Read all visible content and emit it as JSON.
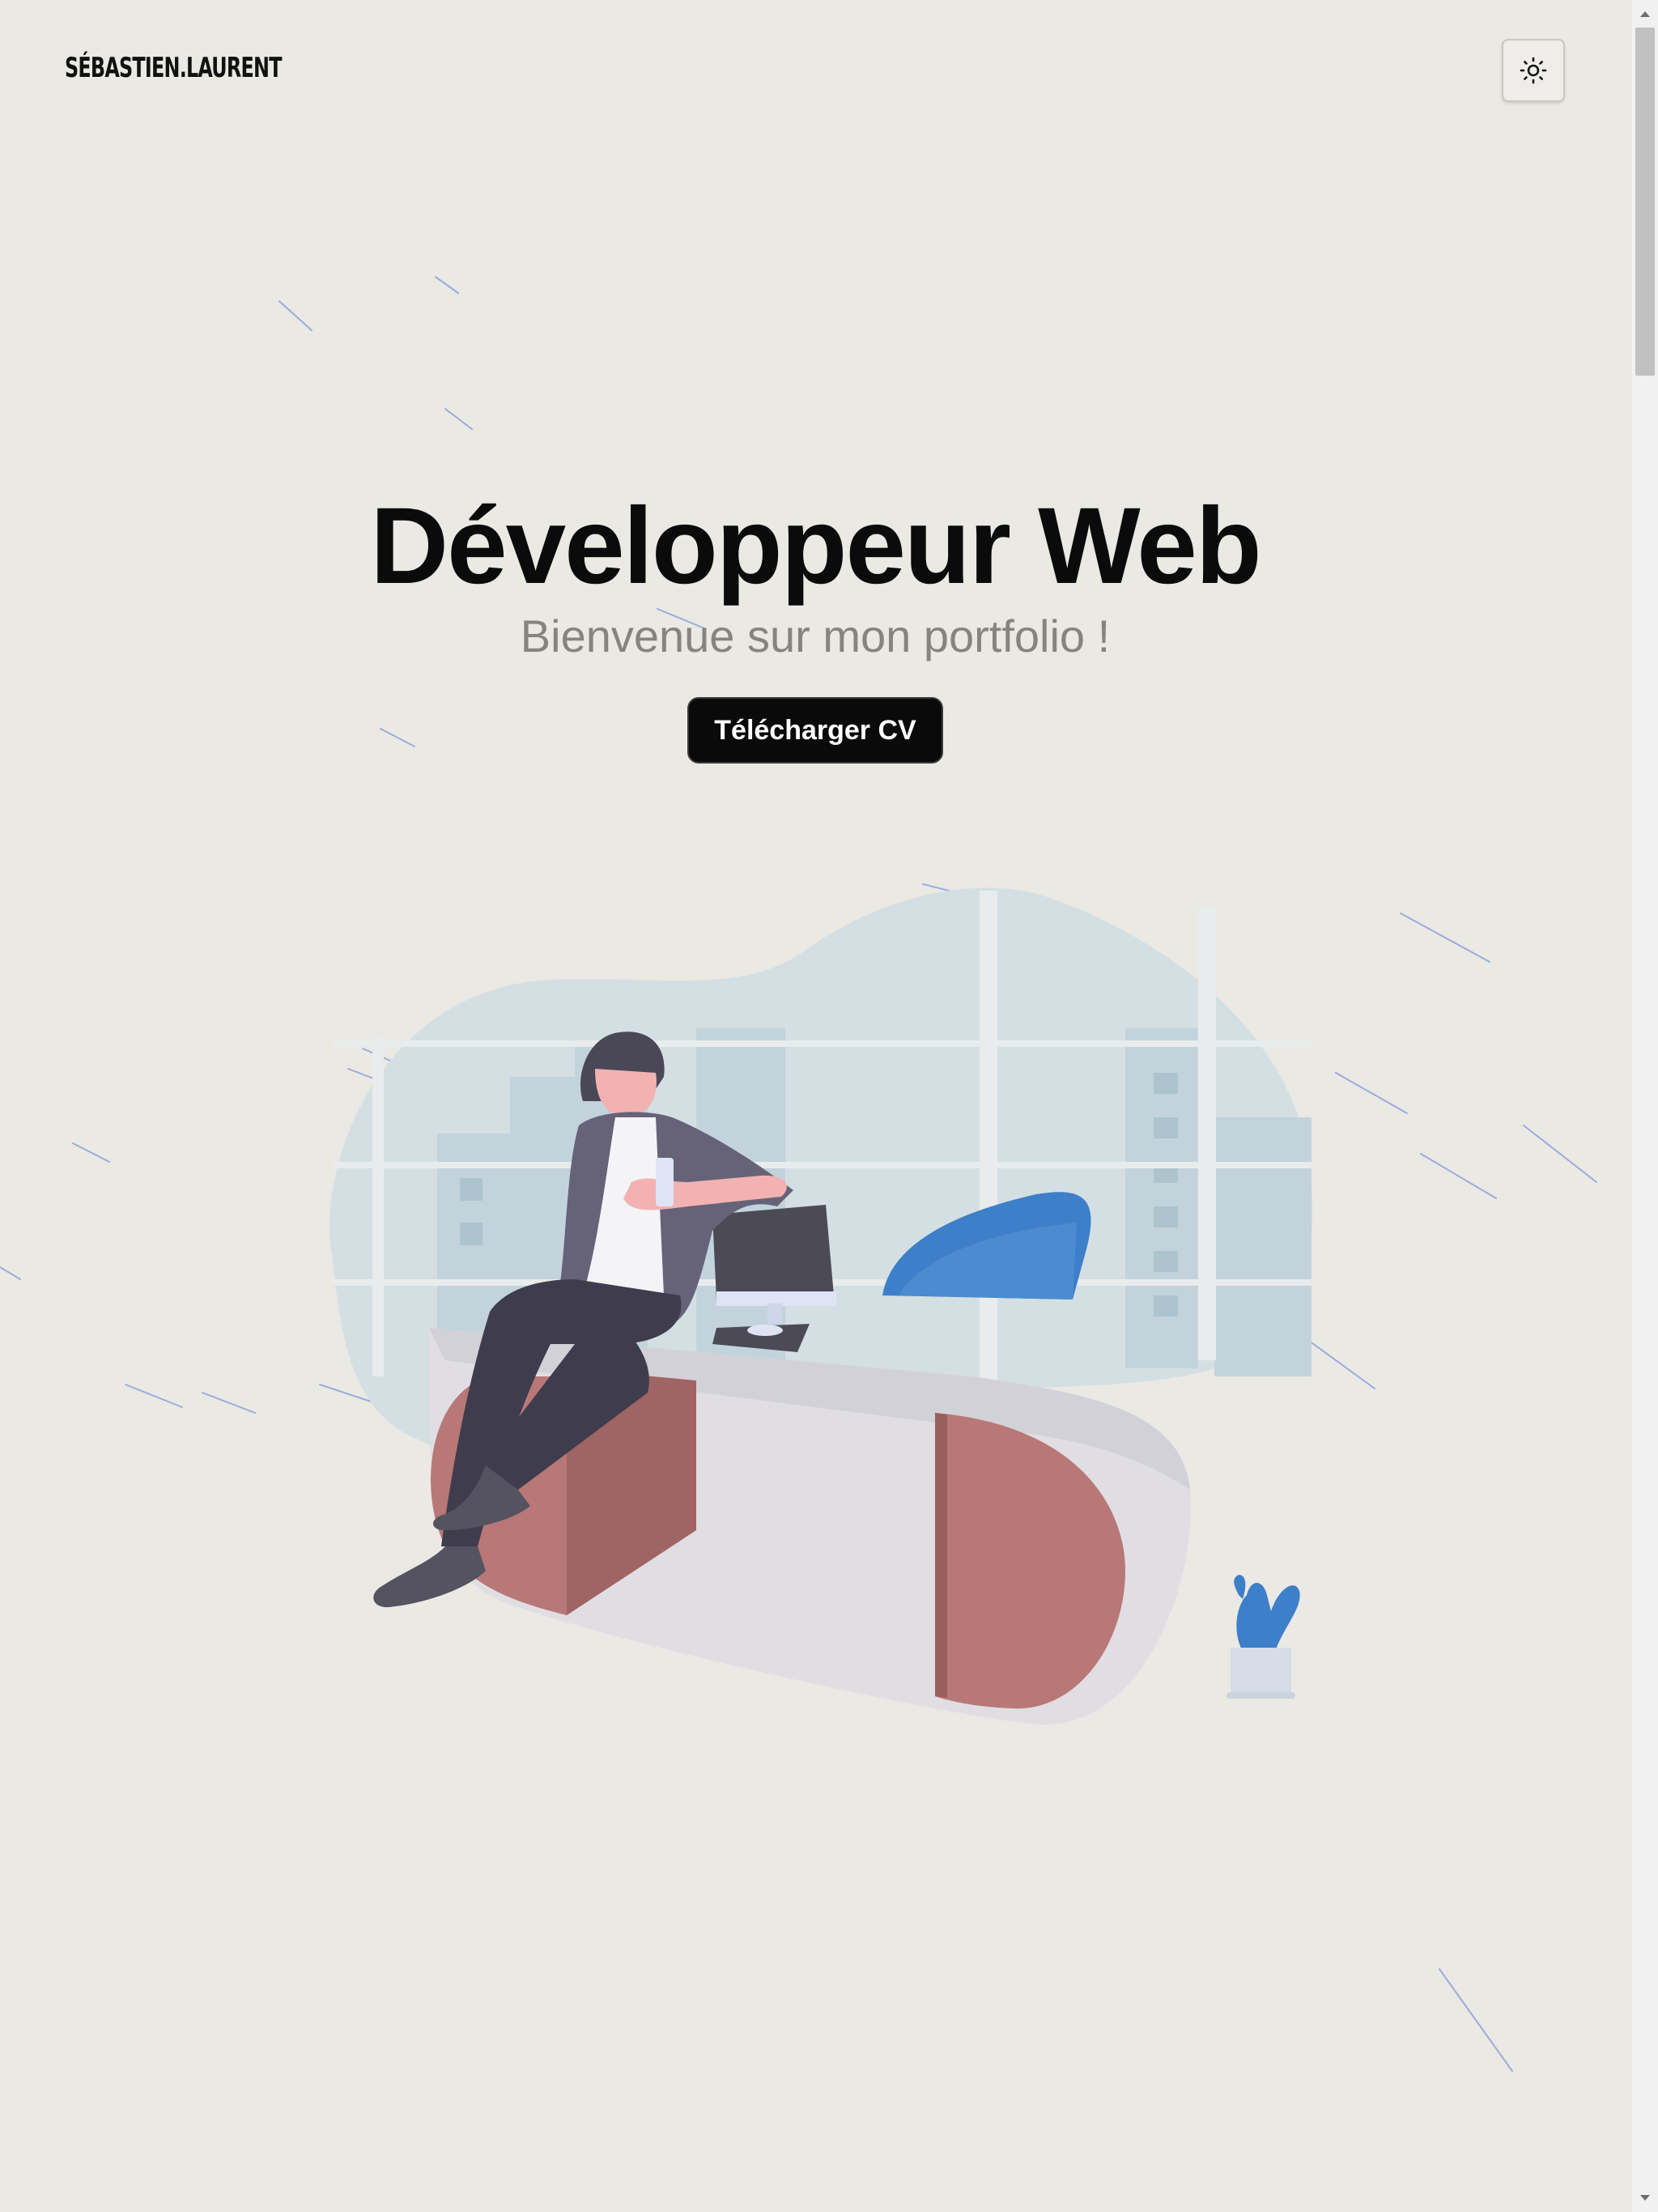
{
  "header": {
    "brand": "SÉBASTIEN.LAURENT",
    "theme_toggle_icon": "sun-icon"
  },
  "hero": {
    "title": "Développeur Web",
    "subtitle": "Bienvenue sur mon portfolio !",
    "cta_label": "Télécharger CV"
  },
  "illustration": {
    "icon": "developer-at-desk-illustration"
  },
  "colors": {
    "background": "#ebe9e4",
    "title": "#0b0b0b",
    "subtitle": "#858480",
    "button_bg": "#0a0a0a",
    "button_text": "#ffffff",
    "accent_blue": "#3d7fc8",
    "desk_red": "#b87878",
    "streak_blue": "#6f8fd6"
  },
  "scrollbar": {
    "up_icon": "scroll-up-arrow-icon",
    "down_icon": "scroll-down-arrow-icon"
  }
}
